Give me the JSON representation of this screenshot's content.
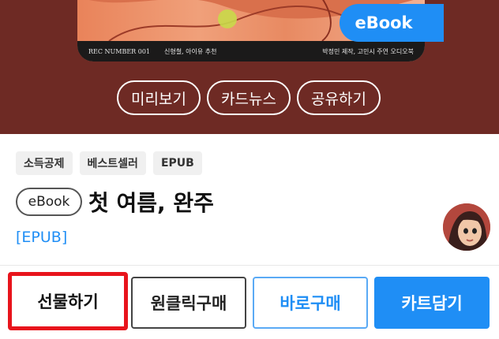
{
  "cover": {
    "strip_left": "REC NUMBER 001",
    "strip_mid": "신형철, 아이유 추천",
    "strip_right": "박정민 제작, 고민시 주연 오디오북"
  },
  "flag": {
    "label": "eBook"
  },
  "actions": [
    "미리보기",
    "카드뉴스",
    "공유하기"
  ],
  "tags": [
    "소득공제",
    "베스트셀러",
    "EPUB"
  ],
  "book": {
    "format_badge": "eBook",
    "title": "첫 여름, 완주",
    "file_format": "[EPUB]"
  },
  "buttons": {
    "gift": "선물하기",
    "one_click": "원클릭구매",
    "buy_now": "바로구매",
    "add_cart": "카트담기"
  },
  "colors": {
    "hero_bg": "#6e2a24",
    "accent": "#1f8ef5",
    "highlight": "#e8141c"
  }
}
